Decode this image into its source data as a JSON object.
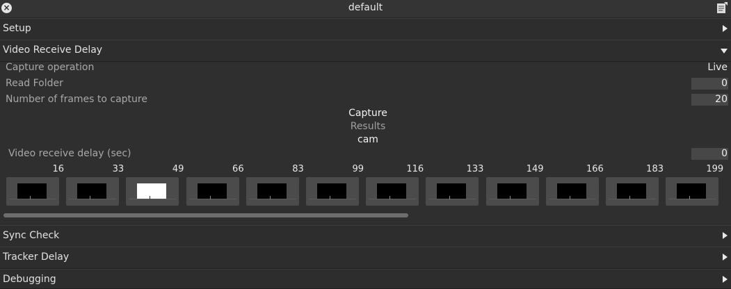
{
  "window": {
    "title": "default"
  },
  "sections": {
    "setup": "Setup",
    "video_receive_delay": "Video Receive Delay",
    "sync_check": "Sync Check",
    "tracker_delay": "Tracker Delay",
    "debugging": "Debugging"
  },
  "props": {
    "capture_operation": {
      "label": "Capture operation",
      "value": "Live"
    },
    "read_folder": {
      "label": "Read Folder",
      "value": "0"
    },
    "num_frames": {
      "label": "Number of frames to capture",
      "value": "20"
    }
  },
  "center": {
    "capture_button": "Capture",
    "results_label": "Results",
    "cam_label": "cam"
  },
  "delay": {
    "label": "Video receive delay (sec)",
    "value": "0"
  },
  "ticks": [
    "16",
    "33",
    "49",
    "66",
    "83",
    "99",
    "116",
    "133",
    "149",
    "166",
    "183",
    "199"
  ],
  "frames": {
    "count": 12,
    "selected_index": 2
  },
  "colors": {
    "background": "#2f2f2f",
    "field": "#474747",
    "thumbnail": "#4b4b4b",
    "selected_frame": "#ffffff"
  },
  "icons": {
    "close": "close-icon",
    "document": "document-icon",
    "expand": "chevron-right-icon",
    "collapse": "chevron-down-icon"
  }
}
